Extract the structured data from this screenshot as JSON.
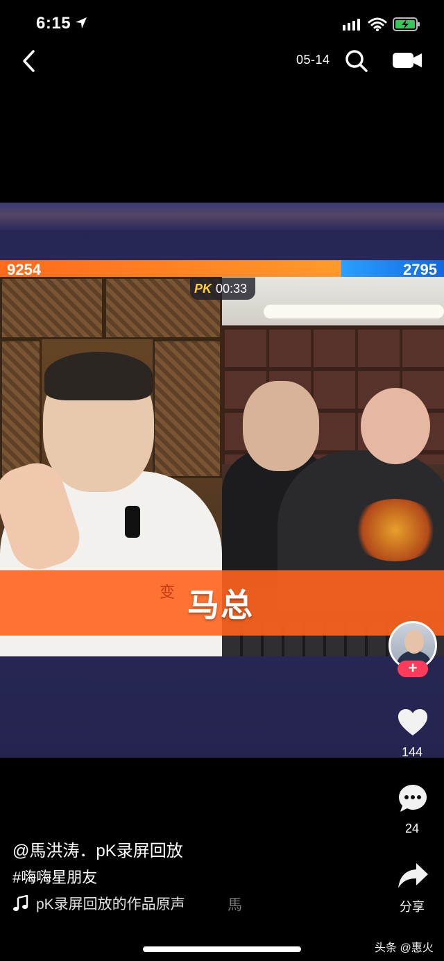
{
  "status_bar": {
    "time": "6:15"
  },
  "top_nav": {
    "date": "05-14"
  },
  "pk": {
    "score_left": "9254",
    "score_right": "2795",
    "timer": "00:33",
    "logo": "PK",
    "left_fraction": 0.768
  },
  "video": {
    "banner_text": "马总",
    "banner_mark": "变"
  },
  "rail": {
    "follow_symbol": "+",
    "like_count": "144",
    "comment_count": "24",
    "share_label": "分享"
  },
  "caption": {
    "author_line": "@馬洪涛．pK录屏回放",
    "hashtag": "#嗨嗨星朋友",
    "music": "pK录屏回放的作品原声",
    "music_overflow": "馬"
  },
  "watermark": "头条 @惠火",
  "colors": {
    "pk_left": "#ff7a1f",
    "pk_right": "#1f80f0",
    "follow": "#ff3b5c",
    "banner": "#ff641e"
  }
}
